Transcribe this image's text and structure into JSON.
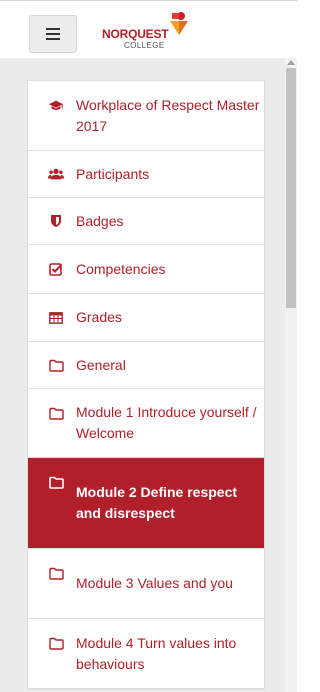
{
  "header": {
    "logo_name": "NORQUEST",
    "logo_sub": "COLLEGE",
    "menu_icon": "hamburger-icon"
  },
  "nav": {
    "items": [
      {
        "label": "Workplace of Respect Master 2017",
        "icon": "graduation-cap-icon"
      },
      {
        "label": "Participants",
        "icon": "users-icon"
      },
      {
        "label": "Badges",
        "icon": "shield-icon"
      },
      {
        "label": "Competencies",
        "icon": "checkbox-icon"
      },
      {
        "label": "Grades",
        "icon": "table-icon"
      },
      {
        "label": "General",
        "icon": "folder-icon"
      },
      {
        "label": "Module 1 Introduce yourself / Welcome",
        "icon": "folder-icon"
      },
      {
        "label": "Module 2 Define respect and disrespect",
        "icon": "folder-icon",
        "active": true
      },
      {
        "label": "Module 3 Values and you",
        "icon": "folder-icon"
      },
      {
        "label": "Module 4 Turn values into behaviours",
        "icon": "folder-icon"
      }
    ]
  },
  "colors": {
    "accent": "#b11f2a",
    "drawer_bg": "#ebebeb"
  }
}
